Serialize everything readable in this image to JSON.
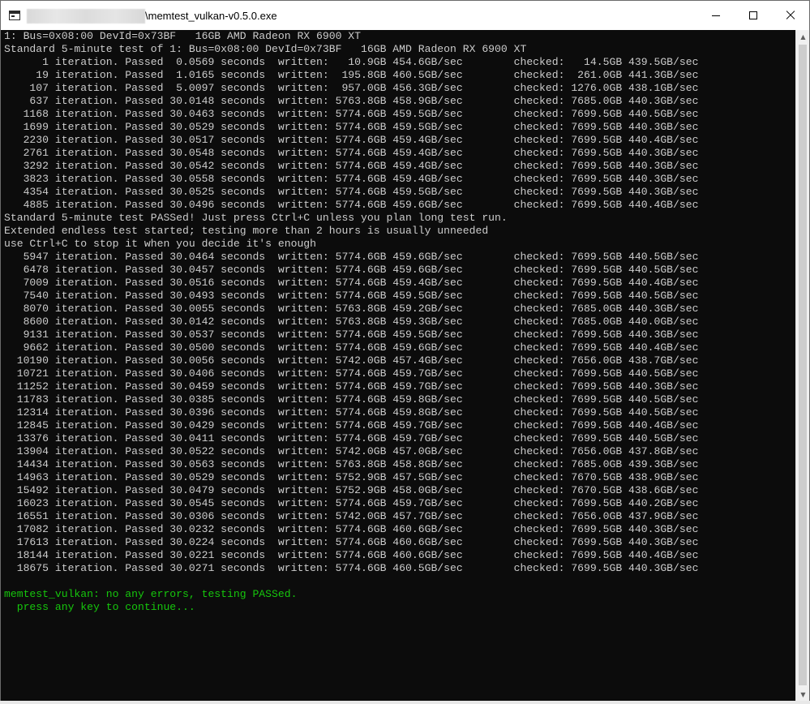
{
  "window": {
    "title": "\\memtest_vulkan-v0.5.0.exe",
    "controls": [
      "minimize",
      "maximize",
      "close"
    ]
  },
  "console": {
    "lines": [
      {
        "text": "1: Bus=0x08:00 DevId=0x73BF   16GB AMD Radeon RX 6900 XT",
        "color": "#cccccc"
      },
      {
        "text": "Standard 5-minute test of 1: Bus=0x08:00 DevId=0x73BF   16GB AMD Radeon RX 6900 XT",
        "color": "#cccccc"
      },
      {
        "text": "      1 iteration. Passed  0.0569 seconds  written:   10.9GB 454.6GB/sec        checked:   14.5GB 439.5GB/sec",
        "color": "#cccccc"
      },
      {
        "text": "     19 iteration. Passed  1.0165 seconds  written:  195.8GB 460.5GB/sec        checked:  261.0GB 441.3GB/sec",
        "color": "#cccccc"
      },
      {
        "text": "    107 iteration. Passed  5.0097 seconds  written:  957.0GB 456.3GB/sec        checked: 1276.0GB 438.1GB/sec",
        "color": "#cccccc"
      },
      {
        "text": "    637 iteration. Passed 30.0148 seconds  written: 5763.8GB 458.9GB/sec        checked: 7685.0GB 440.3GB/sec",
        "color": "#cccccc"
      },
      {
        "text": "   1168 iteration. Passed 30.0463 seconds  written: 5774.6GB 459.5GB/sec        checked: 7699.5GB 440.5GB/sec",
        "color": "#cccccc"
      },
      {
        "text": "   1699 iteration. Passed 30.0529 seconds  written: 5774.6GB 459.5GB/sec        checked: 7699.5GB 440.3GB/sec",
        "color": "#cccccc"
      },
      {
        "text": "   2230 iteration. Passed 30.0517 seconds  written: 5774.6GB 459.4GB/sec        checked: 7699.5GB 440.4GB/sec",
        "color": "#cccccc"
      },
      {
        "text": "   2761 iteration. Passed 30.0548 seconds  written: 5774.6GB 459.4GB/sec        checked: 7699.5GB 440.3GB/sec",
        "color": "#cccccc"
      },
      {
        "text": "   3292 iteration. Passed 30.0542 seconds  written: 5774.6GB 459.4GB/sec        checked: 7699.5GB 440.3GB/sec",
        "color": "#cccccc"
      },
      {
        "text": "   3823 iteration. Passed 30.0558 seconds  written: 5774.6GB 459.4GB/sec        checked: 7699.5GB 440.3GB/sec",
        "color": "#cccccc"
      },
      {
        "text": "   4354 iteration. Passed 30.0525 seconds  written: 5774.6GB 459.5GB/sec        checked: 7699.5GB 440.3GB/sec",
        "color": "#cccccc"
      },
      {
        "text": "   4885 iteration. Passed 30.0496 seconds  written: 5774.6GB 459.6GB/sec        checked: 7699.5GB 440.4GB/sec",
        "color": "#cccccc"
      },
      {
        "text": "Standard 5-minute test PASSed! Just press Ctrl+C unless you plan long test run.",
        "color": "#cccccc"
      },
      {
        "text": "Extended endless test started; testing more than 2 hours is usually unneeded",
        "color": "#cccccc"
      },
      {
        "text": "use Ctrl+C to stop it when you decide it's enough",
        "color": "#cccccc"
      },
      {
        "text": "   5947 iteration. Passed 30.0464 seconds  written: 5774.6GB 459.6GB/sec        checked: 7699.5GB 440.5GB/sec",
        "color": "#cccccc"
      },
      {
        "text": "   6478 iteration. Passed 30.0457 seconds  written: 5774.6GB 459.6GB/sec        checked: 7699.5GB 440.5GB/sec",
        "color": "#cccccc"
      },
      {
        "text": "   7009 iteration. Passed 30.0516 seconds  written: 5774.6GB 459.4GB/sec        checked: 7699.5GB 440.4GB/sec",
        "color": "#cccccc"
      },
      {
        "text": "   7540 iteration. Passed 30.0493 seconds  written: 5774.6GB 459.5GB/sec        checked: 7699.5GB 440.5GB/sec",
        "color": "#cccccc"
      },
      {
        "text": "   8070 iteration. Passed 30.0055 seconds  written: 5763.8GB 459.2GB/sec        checked: 7685.0GB 440.3GB/sec",
        "color": "#cccccc"
      },
      {
        "text": "   8600 iteration. Passed 30.0142 seconds  written: 5763.8GB 459.3GB/sec        checked: 7685.0GB 440.0GB/sec",
        "color": "#cccccc"
      },
      {
        "text": "   9131 iteration. Passed 30.0537 seconds  written: 5774.6GB 459.5GB/sec        checked: 7699.5GB 440.3GB/sec",
        "color": "#cccccc"
      },
      {
        "text": "   9662 iteration. Passed 30.0500 seconds  written: 5774.6GB 459.6GB/sec        checked: 7699.5GB 440.4GB/sec",
        "color": "#cccccc"
      },
      {
        "text": "  10190 iteration. Passed 30.0056 seconds  written: 5742.0GB 457.4GB/sec        checked: 7656.0GB 438.7GB/sec",
        "color": "#cccccc"
      },
      {
        "text": "  10721 iteration. Passed 30.0406 seconds  written: 5774.6GB 459.7GB/sec        checked: 7699.5GB 440.5GB/sec",
        "color": "#cccccc"
      },
      {
        "text": "  11252 iteration. Passed 30.0459 seconds  written: 5774.6GB 459.7GB/sec        checked: 7699.5GB 440.3GB/sec",
        "color": "#cccccc"
      },
      {
        "text": "  11783 iteration. Passed 30.0385 seconds  written: 5774.6GB 459.8GB/sec        checked: 7699.5GB 440.5GB/sec",
        "color": "#cccccc"
      },
      {
        "text": "  12314 iteration. Passed 30.0396 seconds  written: 5774.6GB 459.8GB/sec        checked: 7699.5GB 440.5GB/sec",
        "color": "#cccccc"
      },
      {
        "text": "  12845 iteration. Passed 30.0429 seconds  written: 5774.6GB 459.7GB/sec        checked: 7699.5GB 440.4GB/sec",
        "color": "#cccccc"
      },
      {
        "text": "  13376 iteration. Passed 30.0411 seconds  written: 5774.6GB 459.7GB/sec        checked: 7699.5GB 440.5GB/sec",
        "color": "#cccccc"
      },
      {
        "text": "  13904 iteration. Passed 30.0522 seconds  written: 5742.0GB 457.0GB/sec        checked: 7656.0GB 437.8GB/sec",
        "color": "#cccccc"
      },
      {
        "text": "  14434 iteration. Passed 30.0563 seconds  written: 5763.8GB 458.8GB/sec        checked: 7685.0GB 439.3GB/sec",
        "color": "#cccccc"
      },
      {
        "text": "  14963 iteration. Passed 30.0529 seconds  written: 5752.9GB 457.5GB/sec        checked: 7670.5GB 438.9GB/sec",
        "color": "#cccccc"
      },
      {
        "text": "  15492 iteration. Passed 30.0479 seconds  written: 5752.9GB 458.0GB/sec        checked: 7670.5GB 438.6GB/sec",
        "color": "#cccccc"
      },
      {
        "text": "  16023 iteration. Passed 30.0545 seconds  written: 5774.6GB 459.7GB/sec        checked: 7699.5GB 440.2GB/sec",
        "color": "#cccccc"
      },
      {
        "text": "  16551 iteration. Passed 30.0306 seconds  written: 5742.0GB 457.7GB/sec        checked: 7656.0GB 437.9GB/sec",
        "color": "#cccccc"
      },
      {
        "text": "  17082 iteration. Passed 30.0232 seconds  written: 5774.6GB 460.6GB/sec        checked: 7699.5GB 440.3GB/sec",
        "color": "#cccccc"
      },
      {
        "text": "  17613 iteration. Passed 30.0224 seconds  written: 5774.6GB 460.6GB/sec        checked: 7699.5GB 440.3GB/sec",
        "color": "#cccccc"
      },
      {
        "text": "  18144 iteration. Passed 30.0221 seconds  written: 5774.6GB 460.6GB/sec        checked: 7699.5GB 440.4GB/sec",
        "color": "#cccccc"
      },
      {
        "text": "  18675 iteration. Passed 30.0271 seconds  written: 5774.6GB 460.5GB/sec        checked: 7699.5GB 440.3GB/sec",
        "color": "#cccccc"
      },
      {
        "text": "",
        "color": "#cccccc"
      },
      {
        "text": "memtest_vulkan: no any errors, testing PASSed.",
        "color": "#16c60c"
      },
      {
        "text": "  press any key to continue...",
        "color": "#16c60c"
      }
    ]
  },
  "icons": {
    "app": "console-app-icon",
    "minimize": "minimize-icon",
    "maximize": "maximize-icon",
    "close": "close-icon",
    "scroll_up": "scroll-up-arrow-icon",
    "scroll_down": "scroll-down-arrow-icon"
  },
  "colors": {
    "console_bg": "#0c0c0c",
    "console_text": "#cccccc",
    "success_text": "#16c60c",
    "titlebar_bg": "#ffffff"
  }
}
